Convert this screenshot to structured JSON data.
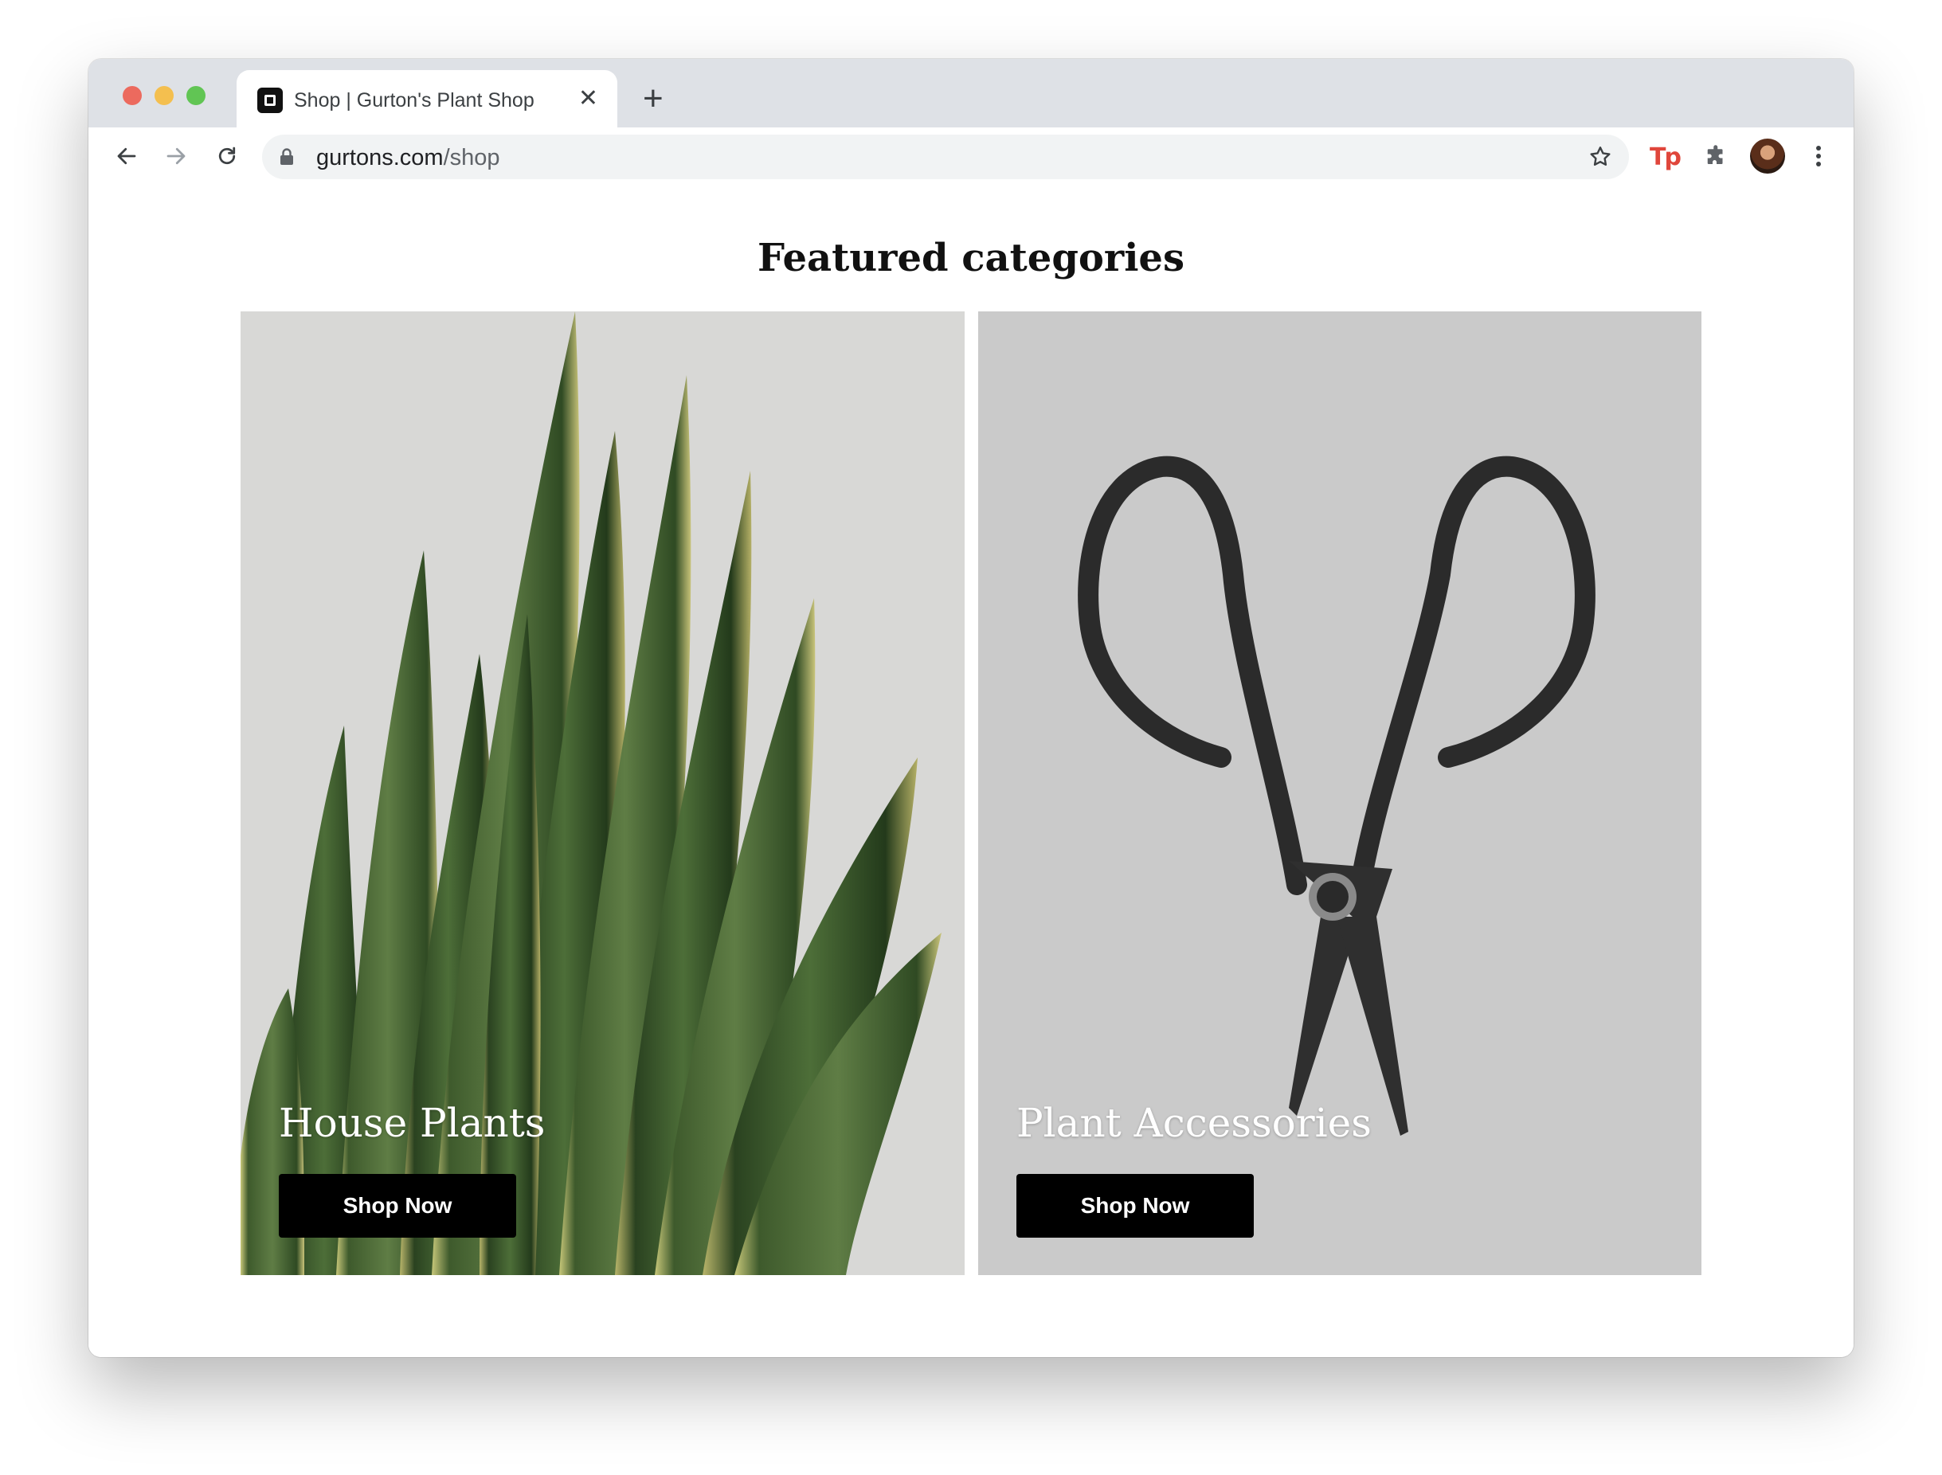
{
  "browser": {
    "tab": {
      "title": "Shop | Gurton's Plant Shop",
      "close_glyph": "✕"
    },
    "new_tab_glyph": "+",
    "address_bar": {
      "domain": "gurtons.com",
      "path": "/shop"
    },
    "extension_badge": "Tp",
    "icons": [
      "back-arrow-icon",
      "forward-arrow-icon",
      "reload-icon",
      "lock-icon",
      "bookmark-star-icon",
      "extension-tp-icon",
      "puzzle-extensions-icon",
      "profile-avatar",
      "kebab-menu-icon"
    ]
  },
  "page": {
    "heading": "Featured categories",
    "categories": [
      {
        "title": "House Plants",
        "button_label": "Shop Now"
      },
      {
        "title": "Plant Accessories",
        "button_label": "Shop Now"
      }
    ]
  },
  "colors": {
    "button_bg": "#000000",
    "button_text": "#ffffff",
    "tab_strip": "#dee1e6",
    "extension_red": "#e0463b"
  }
}
